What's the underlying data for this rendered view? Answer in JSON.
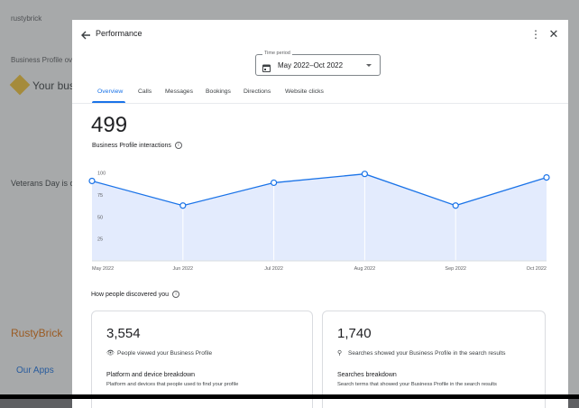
{
  "background": {
    "site_name": "rustybrick",
    "items": [
      "Business Profile overview",
      "Your business",
      "Veterans Day is coming up",
      "RustyBrick",
      "Our Apps"
    ]
  },
  "header": {
    "title": "Performance"
  },
  "time_period": {
    "label": "Time period",
    "value": "May 2022–Oct 2022"
  },
  "tabs": [
    {
      "label": "Overview",
      "active": true
    },
    {
      "label": "Calls",
      "active": false
    },
    {
      "label": "Messages",
      "active": false
    },
    {
      "label": "Bookings",
      "active": false
    },
    {
      "label": "Directions",
      "active": false
    },
    {
      "label": "Website clicks",
      "active": false
    }
  ],
  "summary": {
    "total": "499",
    "label": "Business Profile interactions"
  },
  "chart_data": {
    "type": "area",
    "categories": [
      "May 2022",
      "Jun 2022",
      "Jul 2022",
      "Aug 2022",
      "Sep 2022",
      "Oct 2022"
    ],
    "values": [
      91,
      63,
      89,
      99,
      63,
      95
    ],
    "ylim": [
      0,
      110
    ],
    "yticks": [
      25,
      50,
      75,
      100
    ],
    "grid": true,
    "color": "#1a73e8",
    "fill": "#e3ebfd"
  },
  "discovery": {
    "title": "How people discovered you",
    "cards": [
      {
        "number": "3,554",
        "icon": "eye-icon",
        "text": "People viewed your Business Profile",
        "heading": "Platform and device breakdown",
        "description": "Platform and devices that people used to find your profile"
      },
      {
        "number": "1,740",
        "icon": "search-icon",
        "text": "Searches showed your Business Profile in the search results",
        "heading": "Searches breakdown",
        "description": "Search terms that showed your Business Profile in the search results"
      }
    ]
  }
}
